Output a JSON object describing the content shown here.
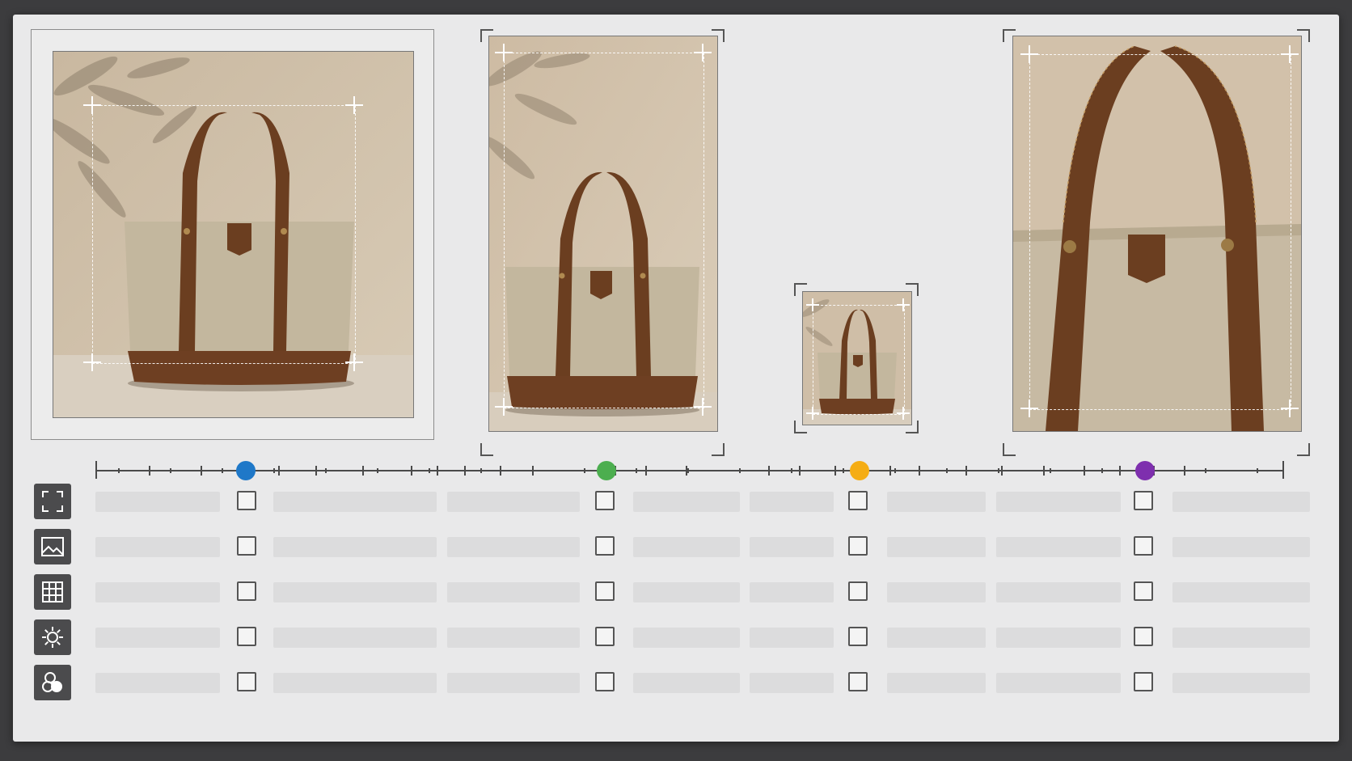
{
  "colors": {
    "panel": "#e9e9ea",
    "backdrop": "#3c3c3e",
    "markers": [
      "#1f78c8",
      "#4cae4f",
      "#f5ad14",
      "#7e2fae"
    ]
  },
  "frames": [
    {
      "name": "crop-frame-landscape",
      "style": "framed-border",
      "subject": "canvas-tote-bag"
    },
    {
      "name": "crop-frame-portrait",
      "style": "corner-brackets",
      "subject": "canvas-tote-bag"
    },
    {
      "name": "crop-frame-thumbnail",
      "style": "corner-brackets",
      "subject": "canvas-tote-bag"
    },
    {
      "name": "crop-frame-closeup",
      "style": "corner-brackets",
      "subject": "canvas-tote-bag-detail"
    }
  ],
  "timeline": {
    "markers": 4
  },
  "rows": [
    {
      "icon": "crop-frame-icon",
      "checked": [
        false,
        false,
        false,
        false
      ]
    },
    {
      "icon": "image-icon",
      "checked": [
        false,
        false,
        false,
        false
      ]
    },
    {
      "icon": "grid-icon",
      "checked": [
        false,
        false,
        false,
        false
      ]
    },
    {
      "icon": "brightness-icon",
      "checked": [
        false,
        false,
        false,
        false
      ]
    },
    {
      "icon": "color-channels-icon",
      "checked": [
        false,
        false,
        false,
        false
      ]
    }
  ]
}
